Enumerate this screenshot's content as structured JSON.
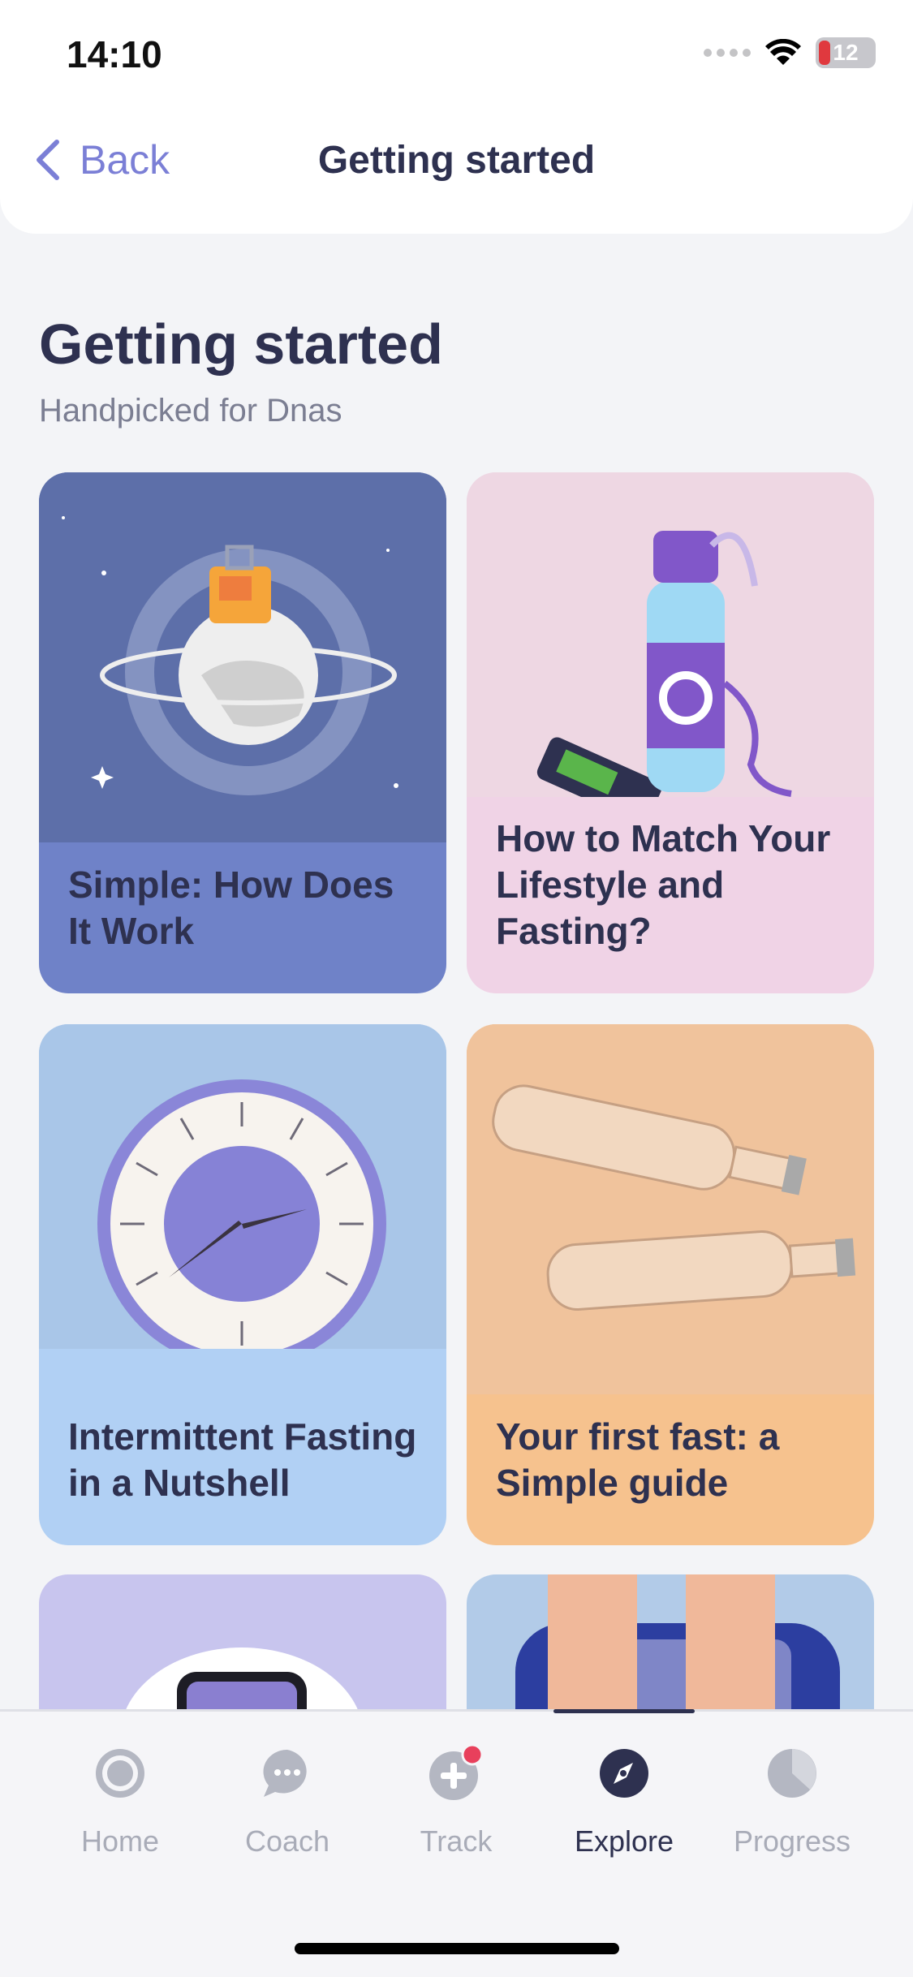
{
  "status_bar": {
    "time": "14:10",
    "battery": "12"
  },
  "nav": {
    "back_label": "Back",
    "title": "Getting started"
  },
  "page": {
    "title": "Getting started",
    "subtitle": "Handpicked for Dnas"
  },
  "cards": [
    {
      "title": "Simple: How Does It Work"
    },
    {
      "title": "How to Match Your Lifestyle and Fasting?"
    },
    {
      "title": "Intermittent Fasting in a Nutshell"
    },
    {
      "title": "Your first fast: a Simple guide"
    }
  ],
  "tabs": [
    {
      "label": "Home",
      "icon": "home-icon"
    },
    {
      "label": "Coach",
      "icon": "chat-icon"
    },
    {
      "label": "Track",
      "icon": "plus-icon",
      "has_badge": true
    },
    {
      "label": "Explore",
      "icon": "compass-icon",
      "active": true
    },
    {
      "label": "Progress",
      "icon": "pie-icon"
    }
  ],
  "colors": {
    "accent": "#7b7fd6",
    "text_dark": "#2e3150",
    "text_muted": "#7b7e92",
    "badge": "#e8405c"
  }
}
